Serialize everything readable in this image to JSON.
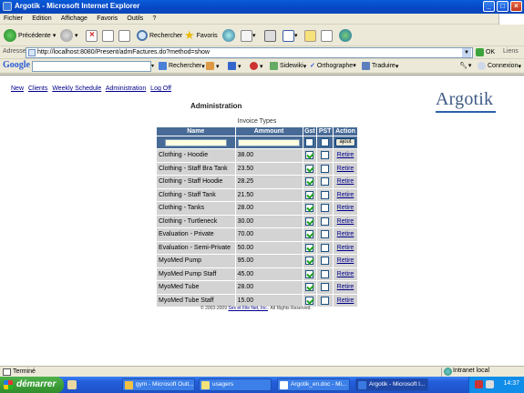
{
  "window": {
    "title": "Argotik - Microsoft Internet Explorer"
  },
  "menu": [
    "Fichier",
    "Edition",
    "Affichage",
    "Favoris",
    "Outils",
    "?"
  ],
  "toolbar": {
    "back_label": "Précédente",
    "search_label": "Rechercher",
    "favorites_label": "Favoris"
  },
  "address": {
    "label": "Adresse",
    "url": "http://localhost:8080/Present/admFactures.do?method=show",
    "go_label": "OK",
    "links_label": "Liens"
  },
  "google_bar": {
    "logo": "Google",
    "search_label": "Rechercher",
    "sidewiki_label": "Sidewiki",
    "spell_label": "Orthographe",
    "translate_label": "Traduire",
    "login_label": "Connexion"
  },
  "nav": [
    "New",
    "Clients",
    "Weekly Schedule",
    "Administration",
    "Log Off"
  ],
  "logo_text": "Argotik",
  "page_title": "Administration",
  "table": {
    "caption": "Invoice Types",
    "headers": {
      "name": "Name",
      "amount": "Ammount",
      "gst": "Gst",
      "pst": "PST",
      "action": "Action"
    },
    "add_label": "ajout",
    "remove_label": "Retire",
    "rows": [
      {
        "name": "Clothing - Hoodie",
        "amount": "38.00",
        "gst": true,
        "pst": false
      },
      {
        "name": "Clothing - Staff Bra Tank",
        "amount": "23.50",
        "gst": true,
        "pst": false
      },
      {
        "name": "Clothing - Staff Hoodie",
        "amount": "28.25",
        "gst": true,
        "pst": false
      },
      {
        "name": "Clothing - Staff Tank",
        "amount": "21.50",
        "gst": true,
        "pst": false
      },
      {
        "name": "Clothing - Tanks",
        "amount": "28.00",
        "gst": true,
        "pst": false
      },
      {
        "name": "Clothing - Turtleneck",
        "amount": "30.00",
        "gst": true,
        "pst": false
      },
      {
        "name": "Evaluation - Private",
        "amount": "70.00",
        "gst": true,
        "pst": false
      },
      {
        "name": "Evaluation - Semi-Private",
        "amount": "50.00",
        "gst": true,
        "pst": false
      },
      {
        "name": "MyoMed Pump",
        "amount": "95.00",
        "gst": true,
        "pst": false
      },
      {
        "name": "MyoMed Pump Staff",
        "amount": "45.00",
        "gst": true,
        "pst": false
      },
      {
        "name": "MyoMed Tube",
        "amount": "28.00",
        "gst": true,
        "pst": false
      },
      {
        "name": "MyoMed Tube Staff",
        "amount": "15.00",
        "gst": true,
        "pst": false
      }
    ]
  },
  "footer": {
    "copyright_prefix": "© 2003-2009",
    "company": "Sex et File Net, Inc.",
    "rights": ". All Rights Reserved."
  },
  "status": {
    "text": "Terminé",
    "zone": "Intranet local"
  },
  "taskbar": {
    "start_label": "démarrer",
    "tasks": [
      "gym - Microsoft Outl...",
      "usagers",
      "Argotik_en.doc - Mi...",
      "Argotik - Microsoft I..."
    ],
    "clock": "14:37"
  },
  "colors": {
    "header_bg": "#476a96",
    "row_bg": "#d3d3d3",
    "link": "#00008b",
    "logo": "#3e5a84"
  }
}
